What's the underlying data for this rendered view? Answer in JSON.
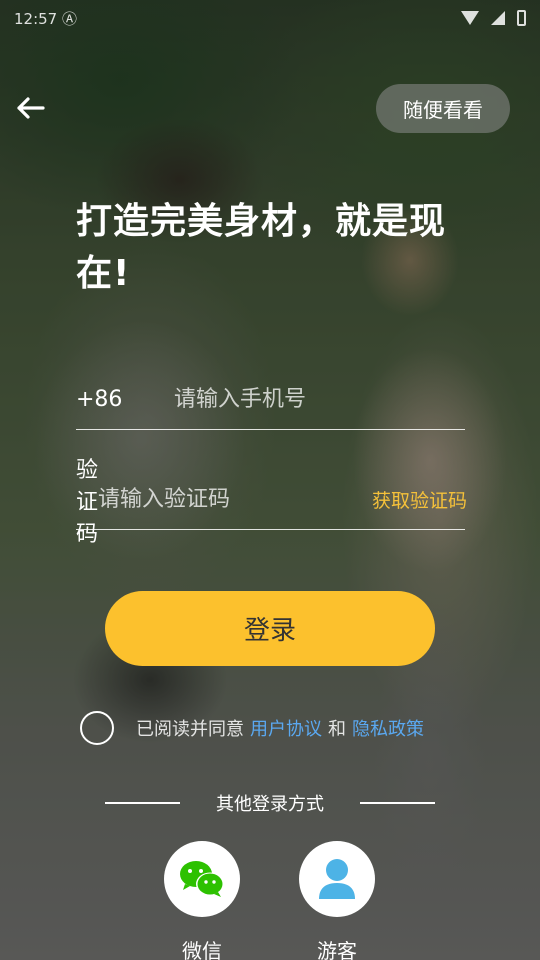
{
  "status_bar": {
    "time": "12:57",
    "extra": "Ⓐ"
  },
  "header": {
    "back_icon": "arrow-left-icon",
    "skip_label": "随便看看"
  },
  "headline": "打造完美身材，就是现在!",
  "phone": {
    "prefix": "+86",
    "placeholder": "请输入手机号"
  },
  "code": {
    "label": "验证码",
    "placeholder": "请输入验证码",
    "get_code_label": "获取验证码"
  },
  "login_label": "登录",
  "agreement": {
    "prefix": "已阅读并同意",
    "user_agreement": "用户协议",
    "and": "和",
    "privacy_policy": "隐私政策"
  },
  "other_login": {
    "label": "其他登录方式",
    "options": [
      {
        "label": "微信",
        "icon": "wechat-icon"
      },
      {
        "label": "游客",
        "icon": "guest-user-icon"
      }
    ]
  },
  "colors": {
    "accent": "#fcc12d",
    "get_code": "#f5c13a",
    "link": "#5aa8f0",
    "wechat": "#2dc100",
    "guest": "#4db3e6"
  }
}
